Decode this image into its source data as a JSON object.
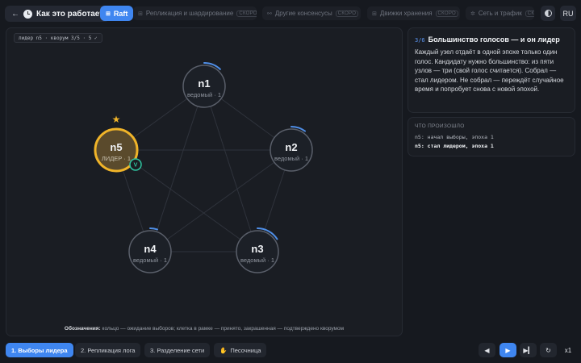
{
  "header": {
    "back_icon": "arrow-left",
    "logo_icon": "clock",
    "home_label": "Как это работает",
    "tabs": [
      {
        "label": "Raft",
        "icon": "grid",
        "active": true
      },
      {
        "label": "Репликация и шардирование",
        "badge": "СКОРО",
        "icon": "grid"
      },
      {
        "label": "Другие консенсусы",
        "badge": "СКОРО",
        "icon": "link"
      },
      {
        "label": "Движки хранения",
        "badge": "СКОРО",
        "icon": "grid"
      },
      {
        "label": "Сеть и трафик",
        "badge": "СКОРО",
        "icon": "gear"
      }
    ],
    "theme_icon": "half-circle",
    "language": "RU"
  },
  "canvas": {
    "status": "лидер n5 · кворум 3/5 · 5 ✓",
    "legend_label": "Обозначения:",
    "legend_text": " кольцо — ожидание выборов; клетка в рамке — принято, закрашенная — подтверждено кворумом"
  },
  "nodes": [
    {
      "id": "n1",
      "role": "ведомый · 1",
      "leader": false,
      "timer": 0.12
    },
    {
      "id": "n2",
      "role": "ведомый · 1",
      "leader": false,
      "timer": 0.1
    },
    {
      "id": "n3",
      "role": "ведомый · 1",
      "leader": false,
      "timer": 0.16
    },
    {
      "id": "n4",
      "role": "ведомый · 1",
      "leader": false,
      "timer": 0.05
    },
    {
      "id": "n5",
      "role": "ЛИДЕР · 1",
      "leader": true,
      "vote_badge": "V"
    }
  ],
  "colors": {
    "accent": "#3f86f0",
    "leader_ring": "#f0b429",
    "leader_fill": "#5a4a2c",
    "vote_badge": "#2fc4a0",
    "timer_arc": "#4f8ee6"
  },
  "info": {
    "step": "3/6",
    "title": "Большинство голосов — и он лидер",
    "body": "Каждый узел отдаёт в одной эпохе только один голос. Кандидату нужно большинство: из пяти узлов — три (свой голос считается). Собрал — стал лидером. Не собрал — переждёт случайное время и попробует снова с новой эпохой."
  },
  "log": {
    "title": "ЧТО ПРОИЗОШЛО",
    "entries": [
      "n5: начал выборы, эпоха 1",
      "n5: стал лидером, эпоха 1"
    ]
  },
  "footer": {
    "scenarios": [
      {
        "label": "1. Выборы лидера",
        "active": true
      },
      {
        "label": "2. Репликация лога"
      },
      {
        "label": "3. Разделение сети"
      },
      {
        "label": "Песочница",
        "icon": "hand"
      }
    ],
    "controls": {
      "prev": "◀",
      "play": "▶",
      "end": "▶▎",
      "reset": "↻",
      "speed": "x1"
    }
  }
}
